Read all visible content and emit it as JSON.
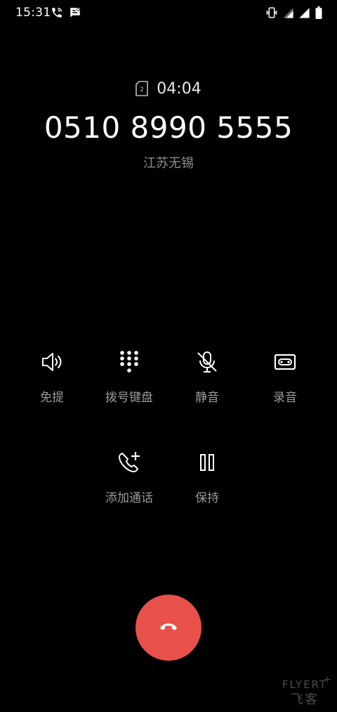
{
  "status_bar": {
    "time": "15:31",
    "left_icons": [
      "wifi-calling-icon",
      "message-notification-icon"
    ],
    "right_icons": [
      "vibrate-icon",
      "signal-sim1-icon",
      "signal-sim2-icon",
      "battery-icon"
    ]
  },
  "call": {
    "sim_slot": "2",
    "duration": "04:04",
    "number": "0510 8990 5555",
    "location": "江苏无锡"
  },
  "controls": [
    {
      "label": "免提",
      "icon": "speaker-icon"
    },
    {
      "label": "拨号键盘",
      "icon": "dialpad-icon"
    },
    {
      "label": "静音",
      "icon": "mute-icon"
    },
    {
      "label": "录音",
      "icon": "record-icon"
    },
    {
      "label": "添加通话",
      "icon": "add-call-icon"
    },
    {
      "label": "保持",
      "icon": "hold-icon"
    }
  ],
  "end_call": {
    "icon": "hang-up-icon",
    "color": "#e8514a"
  },
  "watermark": {
    "top": "FLYERT",
    "plus": "+",
    "bottom": "飞客"
  },
  "colors": {
    "background": "#000000",
    "label": "#9a9a9a",
    "location": "#8d8d8d"
  }
}
